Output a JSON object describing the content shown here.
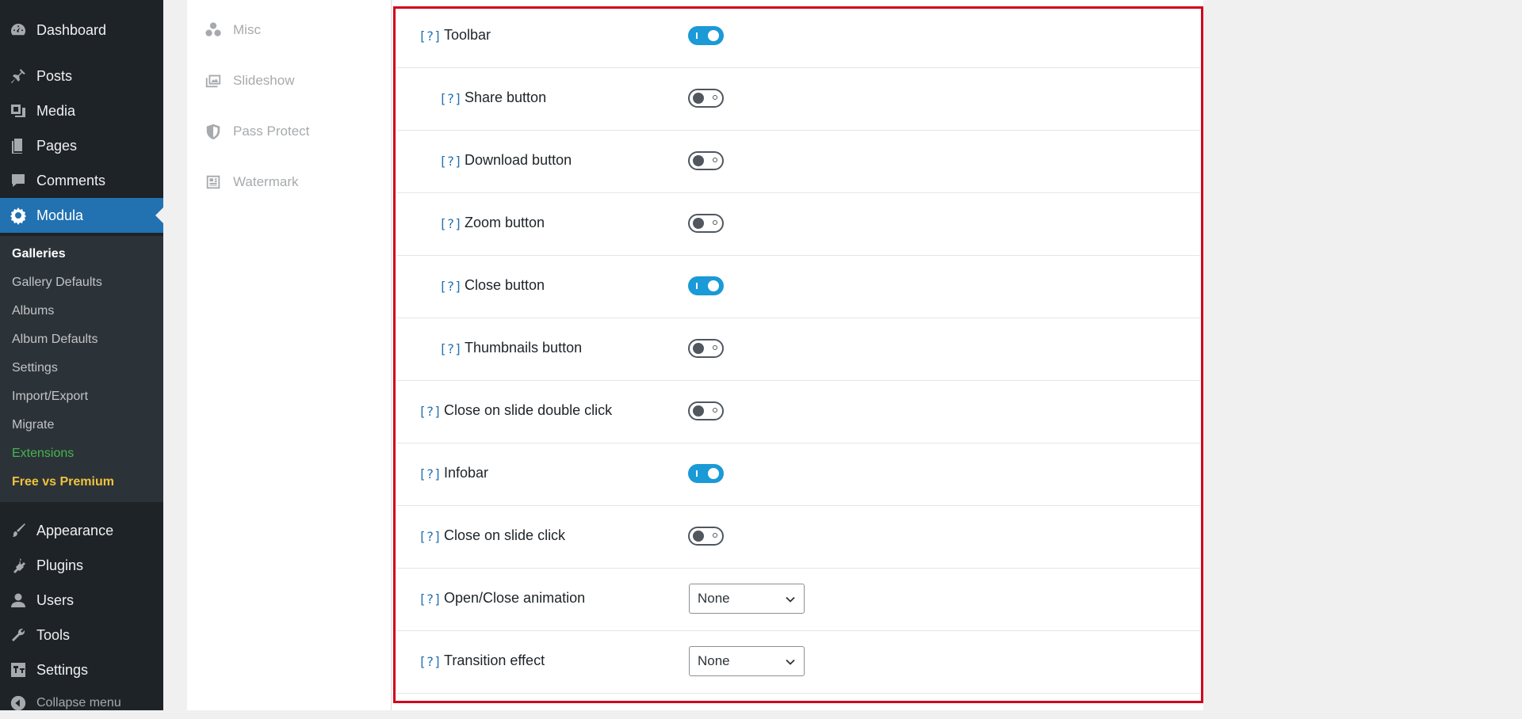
{
  "sidebar": {
    "top_items": [
      {
        "label": "Dashboard",
        "icon": "dashboard-icon"
      },
      {
        "label": "Posts",
        "icon": "pin-icon"
      },
      {
        "label": "Media",
        "icon": "media-icon"
      },
      {
        "label": "Pages",
        "icon": "pages-icon"
      },
      {
        "label": "Comments",
        "icon": "comment-icon"
      },
      {
        "label": "Modula",
        "icon": "gear-icon"
      }
    ],
    "submenu": [
      {
        "label": "Galleries"
      },
      {
        "label": "Gallery Defaults"
      },
      {
        "label": "Albums"
      },
      {
        "label": "Album Defaults"
      },
      {
        "label": "Settings"
      },
      {
        "label": "Import/Export"
      },
      {
        "label": "Migrate"
      },
      {
        "label": "Extensions"
      },
      {
        "label": "Free vs Premium"
      }
    ],
    "bottom_items": [
      {
        "label": "Appearance",
        "icon": "brush-icon"
      },
      {
        "label": "Plugins",
        "icon": "plugin-icon"
      },
      {
        "label": "Users",
        "icon": "user-icon"
      },
      {
        "label": "Tools",
        "icon": "wrench-icon"
      },
      {
        "label": "Settings",
        "icon": "settings-icon"
      }
    ],
    "collapse_label": "Collapse menu"
  },
  "tabs": [
    {
      "label": "Misc",
      "icon": "circles-icon"
    },
    {
      "label": "Slideshow",
      "icon": "images-icon"
    },
    {
      "label": "Pass Protect",
      "icon": "shield-icon"
    },
    {
      "label": "Watermark",
      "icon": "watermark-icon"
    }
  ],
  "options": {
    "help_marker": "[?]",
    "rows": [
      {
        "label": "Toolbar",
        "type": "toggle",
        "value": true,
        "indent": false
      },
      {
        "label": "Share button",
        "type": "toggle",
        "value": false,
        "indent": true
      },
      {
        "label": "Download button",
        "type": "toggle",
        "value": false,
        "indent": true
      },
      {
        "label": "Zoom button",
        "type": "toggle",
        "value": false,
        "indent": true
      },
      {
        "label": "Close button",
        "type": "toggle",
        "value": true,
        "indent": true
      },
      {
        "label": "Thumbnails button",
        "type": "toggle",
        "value": false,
        "indent": true
      },
      {
        "label": "Close on slide double click",
        "type": "toggle",
        "value": false,
        "indent": false
      },
      {
        "label": "Infobar",
        "type": "toggle",
        "value": true,
        "indent": false
      },
      {
        "label": "Close on slide click",
        "type": "toggle",
        "value": false,
        "indent": false
      },
      {
        "label": "Open/Close animation",
        "type": "select",
        "value": "None",
        "indent": false
      },
      {
        "label": "Transition effect",
        "type": "select",
        "value": "None",
        "indent": false
      }
    ]
  },
  "colors": {
    "sidebar_bg": "#1d2327",
    "active_blue": "#2271b1",
    "toggle_on": "#1a9ad6",
    "highlight_border": "#d0021b",
    "extensions_green": "#46b450",
    "premium_yellow": "#f0c33c"
  }
}
